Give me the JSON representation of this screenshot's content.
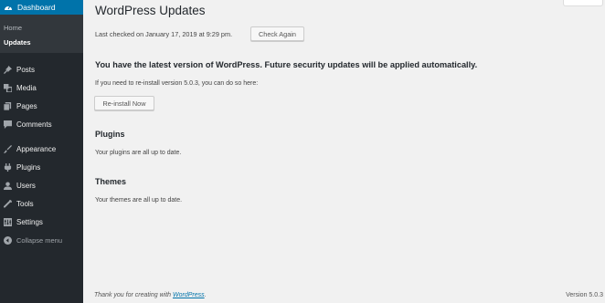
{
  "sidebar": {
    "dashboard_label": "Dashboard",
    "submenu": [
      {
        "label": "Home"
      },
      {
        "label": "Updates"
      }
    ],
    "items": [
      {
        "label": "Posts",
        "icon": "pin-icon"
      },
      {
        "label": "Media",
        "icon": "media-icon"
      },
      {
        "label": "Pages",
        "icon": "pages-icon"
      },
      {
        "label": "Comments",
        "icon": "comment-icon"
      },
      {
        "label": "Appearance",
        "icon": "brush-icon"
      },
      {
        "label": "Plugins",
        "icon": "plug-icon"
      },
      {
        "label": "Users",
        "icon": "user-icon"
      },
      {
        "label": "Tools",
        "icon": "wrench-icon"
      },
      {
        "label": "Settings",
        "icon": "settings-icon"
      }
    ],
    "collapse_label": "Collapse menu"
  },
  "main": {
    "title": "WordPress Updates",
    "last_checked": "Last checked on January 17, 2019 at 9:29 pm.",
    "check_again_label": "Check Again",
    "latest_message": "You have the latest version of WordPress. Future security updates will be applied automatically.",
    "reinstall_note": "If you need to re-install version 5.0.3, you can do so here:",
    "reinstall_label": "Re-install Now",
    "plugins_heading": "Plugins",
    "plugins_text": "Your plugins are all up to date.",
    "themes_heading": "Themes",
    "themes_text": "Your themes are all up to date."
  },
  "footer": {
    "thanks_prefix": "Thank you for creating with ",
    "thanks_link": "WordPress",
    "thanks_suffix": ".",
    "version": "Version 5.0.3"
  },
  "colors": {
    "sidebar_bg": "#23282d",
    "active_blue": "#0073aa",
    "page_bg": "#f1f1f1"
  }
}
